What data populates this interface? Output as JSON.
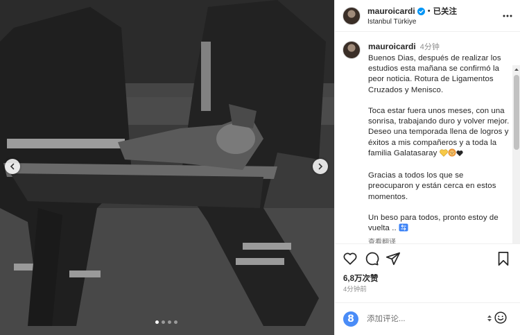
{
  "media": {
    "total_slides": 4,
    "active_slide": 1,
    "prev_icon": "chevron-left-icon",
    "next_icon": "chevron-right-icon"
  },
  "header": {
    "username": "mauroicardi",
    "separator": "•",
    "follow_label": "已关注",
    "location": "Istanbul Türkiye"
  },
  "caption": {
    "username": "mauroicardi",
    "time": "4分钟",
    "text": "Buenos Dias, después de realizar los estudios esta mañana se confirmó la peor noticia. Rotura de Ligamentos Cruzados y Menisco.\n\nToca estar fuera unos meses, con una sonrisa, trabajando duro y volver mejor. Deseo una temporada llena de logros y éxitos a mis compañeros y a toda la familia Galatasaray ",
    "text_part2": "Gracias a todos los que se preocuparon y están cerca en estos momentos.",
    "text_part3": "Un beso para todos, pronto estoy de vuelta .. ",
    "translate_label": "查看翻译"
  },
  "stats": {
    "likes": "6,8万次赞",
    "time_ago": "4分钟前"
  },
  "comment": {
    "placeholder": "添加评论..."
  },
  "colors": {
    "verified_blue": "#0095f6",
    "text": "#262626",
    "muted": "#8e8e8e",
    "comment_logo": "#4a8cf7"
  }
}
